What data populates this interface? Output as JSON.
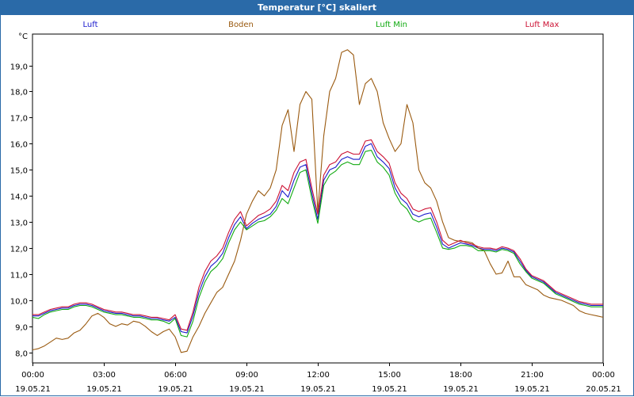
{
  "window": {
    "title": "Temperatur [°C] skaliert"
  },
  "chart_data": {
    "type": "line",
    "title": "Temperatur [°C] skaliert",
    "ylabel": "°C",
    "xlabel": "",
    "ylim": [
      7.6,
      20.2
    ],
    "xlim": [
      0,
      24
    ],
    "grid": true,
    "legend_position": "top",
    "y_ticks": [
      "8,0",
      "9,0",
      "10,0",
      "11,0",
      "12,0",
      "13,0",
      "14,0",
      "15,0",
      "16,0",
      "17,0",
      "18,0",
      "19,0"
    ],
    "y_tick_values": [
      8,
      9,
      10,
      11,
      12,
      13,
      14,
      15,
      16,
      17,
      18,
      19
    ],
    "x_ticks": [
      {
        "time": "00:00",
        "date": "19.05.21"
      },
      {
        "time": "03:00",
        "date": "19.05.21"
      },
      {
        "time": "06:00",
        "date": "19.05.21"
      },
      {
        "time": "09:00",
        "date": "19.05.21"
      },
      {
        "time": "12:00",
        "date": "19.05.21"
      },
      {
        "time": "15:00",
        "date": "19.05.21"
      },
      {
        "time": "18:00",
        "date": "19.05.21"
      },
      {
        "time": "21:00",
        "date": "19.05.21"
      },
      {
        "time": "00:00",
        "date": "20.05.21"
      }
    ],
    "x_tick_values": [
      0,
      3,
      6,
      9,
      12,
      15,
      18,
      21,
      24
    ],
    "series": [
      {
        "name": "Luft",
        "color": "#1a1acc",
        "x": [
          0,
          0.25,
          0.5,
          0.75,
          1,
          1.25,
          1.5,
          1.75,
          2,
          2.25,
          2.5,
          2.75,
          3,
          3.25,
          3.5,
          3.75,
          4,
          4.25,
          4.5,
          4.75,
          5,
          5.25,
          5.5,
          5.75,
          6,
          6.25,
          6.5,
          6.75,
          7,
          7.25,
          7.5,
          7.75,
          8,
          8.25,
          8.5,
          8.75,
          9,
          9.25,
          9.5,
          9.75,
          10,
          10.25,
          10.5,
          10.75,
          11,
          11.25,
          11.5,
          11.75,
          12,
          12.25,
          12.5,
          12.75,
          13,
          13.25,
          13.5,
          13.75,
          14,
          14.25,
          14.5,
          14.75,
          15,
          15.25,
          15.5,
          15.75,
          16,
          16.25,
          16.5,
          16.75,
          17,
          17.25,
          17.5,
          17.75,
          18,
          18.25,
          18.5,
          18.75,
          19,
          19.25,
          19.5,
          19.75,
          20,
          20.25,
          20.5,
          20.75,
          21,
          21.25,
          21.5,
          21.75,
          22,
          22.25,
          22.5,
          22.75,
          23,
          23.25,
          23.5,
          23.75,
          24
        ],
        "values": [
          9.4,
          9.4,
          9.5,
          9.6,
          9.65,
          9.7,
          9.7,
          9.8,
          9.85,
          9.85,
          9.8,
          9.7,
          9.6,
          9.55,
          9.5,
          9.5,
          9.45,
          9.4,
          9.4,
          9.35,
          9.3,
          9.3,
          9.25,
          9.2,
          9.35,
          8.8,
          8.75,
          9.4,
          10.3,
          10.9,
          11.3,
          11.5,
          11.8,
          12.4,
          12.9,
          13.2,
          12.75,
          12.95,
          13.1,
          13.2,
          13.3,
          13.6,
          14.2,
          13.95,
          14.6,
          15.1,
          15.2,
          14.1,
          13.1,
          14.6,
          15.0,
          15.1,
          15.4,
          15.5,
          15.4,
          15.4,
          15.9,
          16.0,
          15.5,
          15.3,
          15.05,
          14.3,
          13.9,
          13.7,
          13.3,
          13.2,
          13.3,
          13.35,
          12.8,
          12.15,
          12.0,
          12.1,
          12.2,
          12.15,
          12.1,
          12.0,
          11.95,
          11.95,
          11.9,
          12.0,
          11.95,
          11.85,
          11.5,
          11.15,
          10.9,
          10.8,
          10.7,
          10.5,
          10.3,
          10.2,
          10.1,
          10.0,
          9.9,
          9.85,
          9.8,
          9.8,
          9.8
        ],
        "values_note": ""
      },
      {
        "name": "Boden",
        "color": "#9a5a10",
        "x": [
          0,
          0.25,
          0.5,
          0.75,
          1,
          1.25,
          1.5,
          1.75,
          2,
          2.25,
          2.5,
          2.75,
          3,
          3.25,
          3.5,
          3.75,
          4,
          4.25,
          4.5,
          4.75,
          5,
          5.25,
          5.5,
          5.75,
          6,
          6.25,
          6.5,
          6.75,
          7,
          7.25,
          7.5,
          7.75,
          8,
          8.25,
          8.5,
          8.75,
          9,
          9.25,
          9.5,
          9.75,
          10,
          10.25,
          10.5,
          10.75,
          11,
          11.25,
          11.5,
          11.75,
          12,
          12.25,
          12.5,
          12.75,
          13,
          13.25,
          13.5,
          13.75,
          14,
          14.25,
          14.5,
          14.75,
          15,
          15.25,
          15.5,
          15.75,
          16,
          16.25,
          16.5,
          16.75,
          17,
          17.25,
          17.5,
          17.75,
          18,
          18.25,
          18.5,
          18.75,
          19,
          19.25,
          19.5,
          19.75,
          20,
          20.25,
          20.5,
          20.75,
          21,
          21.25,
          21.5,
          21.75,
          22,
          22.25,
          22.5,
          22.75,
          23,
          23.25,
          23.5,
          23.75,
          24
        ],
        "values": [
          8.1,
          8.15,
          8.25,
          8.4,
          8.55,
          8.5,
          8.55,
          8.75,
          8.85,
          9.1,
          9.4,
          9.5,
          9.35,
          9.1,
          9.0,
          9.1,
          9.05,
          9.2,
          9.15,
          9.0,
          8.8,
          8.65,
          8.8,
          8.9,
          8.6,
          8.0,
          8.05,
          8.6,
          9.0,
          9.5,
          9.9,
          10.3,
          10.5,
          11.0,
          11.5,
          12.3,
          13.3,
          13.8,
          14.2,
          14.0,
          14.3,
          15.0,
          16.7,
          17.3,
          15.7,
          17.5,
          18.0,
          17.7,
          13.4,
          16.3,
          18.0,
          18.5,
          19.5,
          19.6,
          19.4,
          17.5,
          18.3,
          18.5,
          18.0,
          16.8,
          16.2,
          15.7,
          16.0,
          17.5,
          16.8,
          15.0,
          14.5,
          14.3,
          13.8,
          13.0,
          12.4,
          12.3,
          12.25,
          12.25,
          12.2,
          12.0,
          11.9,
          11.4,
          11.0,
          11.05,
          11.5,
          10.9,
          10.9,
          10.6,
          10.5,
          10.4,
          10.2,
          10.1,
          10.05,
          10.0,
          9.9,
          9.8,
          9.6,
          9.5,
          9.45,
          9.4,
          9.35
        ],
        "values_note": ""
      },
      {
        "name": "Luft Min",
        "color": "#11aa11",
        "x": [
          0,
          0.25,
          0.5,
          0.75,
          1,
          1.25,
          1.5,
          1.75,
          2,
          2.25,
          2.5,
          2.75,
          3,
          3.25,
          3.5,
          3.75,
          4,
          4.25,
          4.5,
          4.75,
          5,
          5.25,
          5.5,
          5.75,
          6,
          6.25,
          6.5,
          6.75,
          7,
          7.25,
          7.5,
          7.75,
          8,
          8.25,
          8.5,
          8.75,
          9,
          9.25,
          9.5,
          9.75,
          10,
          10.25,
          10.5,
          10.75,
          11,
          11.25,
          11.5,
          11.75,
          12,
          12.25,
          12.5,
          12.75,
          13,
          13.25,
          13.5,
          13.75,
          14,
          14.25,
          14.5,
          14.75,
          15,
          15.25,
          15.5,
          15.75,
          16,
          16.25,
          16.5,
          16.75,
          17,
          17.25,
          17.5,
          17.75,
          18,
          18.25,
          18.5,
          18.75,
          19,
          19.25,
          19.5,
          19.75,
          20,
          20.25,
          20.5,
          20.75,
          21,
          21.25,
          21.5,
          21.75,
          22,
          22.25,
          22.5,
          22.75,
          23,
          23.25,
          23.5,
          23.75,
          24
        ],
        "values": [
          9.35,
          9.3,
          9.45,
          9.55,
          9.6,
          9.65,
          9.65,
          9.75,
          9.8,
          9.8,
          9.75,
          9.65,
          9.55,
          9.5,
          9.45,
          9.45,
          9.4,
          9.35,
          9.35,
          9.3,
          9.25,
          9.25,
          9.2,
          9.1,
          9.3,
          8.65,
          8.6,
          9.2,
          10.1,
          10.7,
          11.1,
          11.3,
          11.6,
          12.2,
          12.7,
          13.0,
          12.7,
          12.85,
          13.0,
          13.05,
          13.2,
          13.45,
          13.9,
          13.7,
          14.3,
          14.9,
          15.0,
          13.9,
          12.95,
          14.4,
          14.8,
          14.95,
          15.2,
          15.3,
          15.2,
          15.2,
          15.7,
          15.75,
          15.3,
          15.1,
          14.8,
          14.1,
          13.7,
          13.5,
          13.1,
          13.0,
          13.1,
          13.15,
          12.6,
          12.0,
          11.95,
          12.0,
          12.1,
          12.1,
          12.05,
          11.9,
          11.9,
          11.9,
          11.85,
          11.95,
          11.9,
          11.8,
          11.4,
          11.1,
          10.85,
          10.75,
          10.65,
          10.45,
          10.25,
          10.15,
          10.05,
          9.95,
          9.85,
          9.8,
          9.75,
          9.75,
          9.75
        ],
        "values_note": ""
      },
      {
        "name": "Luft Max",
        "color": "#cc1133",
        "x": [
          0,
          0.25,
          0.5,
          0.75,
          1,
          1.25,
          1.5,
          1.75,
          2,
          2.25,
          2.5,
          2.75,
          3,
          3.25,
          3.5,
          3.75,
          4,
          4.25,
          4.5,
          4.75,
          5,
          5.25,
          5.5,
          5.75,
          6,
          6.25,
          6.5,
          6.75,
          7,
          7.25,
          7.5,
          7.75,
          8,
          8.25,
          8.5,
          8.75,
          9,
          9.25,
          9.5,
          9.75,
          10,
          10.25,
          10.5,
          10.75,
          11,
          11.25,
          11.5,
          11.75,
          12,
          12.25,
          12.5,
          12.75,
          13,
          13.25,
          13.5,
          13.75,
          14,
          14.25,
          14.5,
          14.75,
          15,
          15.25,
          15.5,
          15.75,
          16,
          16.25,
          16.5,
          16.75,
          17,
          17.25,
          17.5,
          17.75,
          18,
          18.25,
          18.5,
          18.75,
          19,
          19.25,
          19.5,
          19.75,
          20,
          20.25,
          20.5,
          20.75,
          21,
          21.25,
          21.5,
          21.75,
          22,
          22.25,
          22.5,
          22.75,
          23,
          23.25,
          23.5,
          23.75,
          24
        ],
        "values": [
          9.45,
          9.45,
          9.55,
          9.65,
          9.7,
          9.75,
          9.75,
          9.85,
          9.9,
          9.9,
          9.85,
          9.75,
          9.65,
          9.6,
          9.55,
          9.55,
          9.5,
          9.45,
          9.45,
          9.4,
          9.35,
          9.35,
          9.3,
          9.25,
          9.45,
          8.9,
          8.85,
          9.55,
          10.5,
          11.1,
          11.5,
          11.7,
          12.0,
          12.6,
          13.1,
          13.4,
          12.85,
          13.05,
          13.25,
          13.35,
          13.5,
          13.8,
          14.4,
          14.2,
          14.9,
          15.3,
          15.4,
          14.3,
          13.3,
          14.8,
          15.2,
          15.3,
          15.6,
          15.7,
          15.6,
          15.6,
          16.1,
          16.15,
          15.7,
          15.5,
          15.25,
          14.5,
          14.1,
          13.9,
          13.5,
          13.4,
          13.5,
          13.55,
          13.0,
          12.3,
          12.1,
          12.2,
          12.3,
          12.2,
          12.15,
          12.05,
          12.0,
          12.0,
          11.95,
          12.05,
          12.0,
          11.9,
          11.6,
          11.2,
          10.95,
          10.85,
          10.75,
          10.55,
          10.35,
          10.25,
          10.15,
          10.05,
          9.95,
          9.9,
          9.85,
          9.85,
          9.85
        ],
        "values_note": ""
      }
    ]
  }
}
